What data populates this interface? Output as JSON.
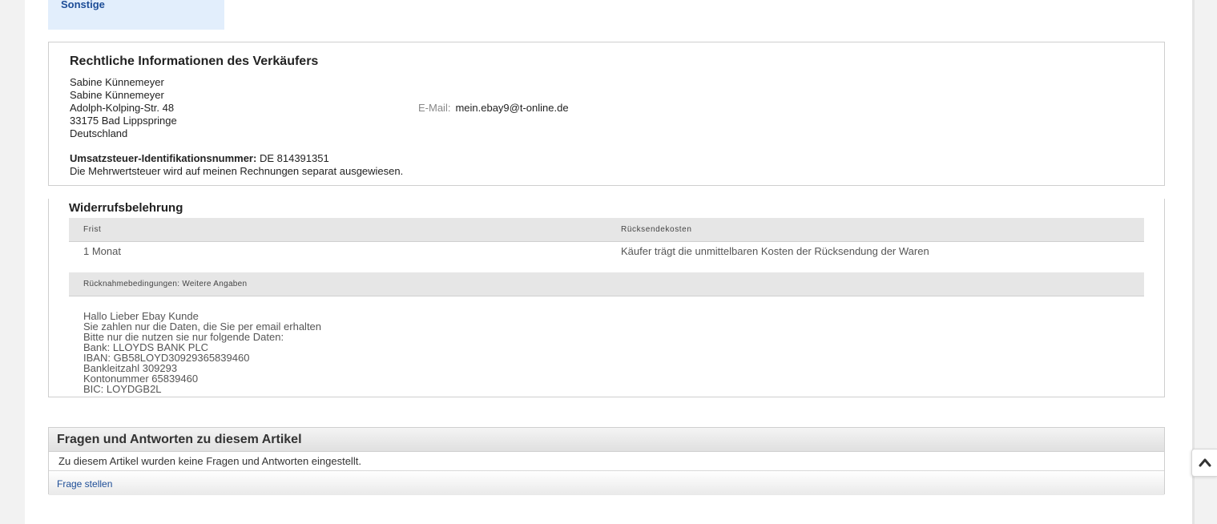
{
  "tabs": {
    "sonstige": "Sonstige"
  },
  "legal": {
    "title": "Rechtliche Informationen des Verkäufers",
    "address": [
      "Sabine Künnemeyer",
      "Sabine Künnemeyer",
      "Adolph-Kolping-Str. 48",
      "33175 Bad Lippspringe",
      "Deutschland"
    ],
    "email_label": "E-Mail:",
    "email_value": "mein.ebay9@t-online.de",
    "vat_label": "Umsatzsteuer-Identifikationsnummer:",
    "vat_value": "DE 814391351",
    "vat_note": "Die Mehrwertsteuer wird auf meinen Rechnungen separat ausgewiesen."
  },
  "widerruf": {
    "title": "Widerrufsbelehrung",
    "col_frist": "Frist",
    "col_kosten": "Rücksendekosten",
    "frist_value": "1 Monat",
    "kosten_value": "Käufer trägt die unmittelbaren Kosten der Rücksendung der Waren",
    "more_header": "Rücknahmebedingungen: Weitere Angaben",
    "more_lines": [
      "Hallo Lieber Ebay Kunde",
      "Sie zahlen nur die Daten, die Sie per email erhalten",
      "Bitte nur die nutzen sie nur folgende Daten:",
      "Bank: LLOYDS BANK PLC",
      "IBAN: GB58LOYD30929365839460",
      "Bankleitzahl 309293",
      "Kontonummer 65839460",
      "BIC: LOYDGB2L"
    ]
  },
  "qa": {
    "title": "Fragen und Antworten zu diesem Artikel",
    "empty_text": "Zu diesem Artikel wurden keine Fragen und Antworten eingestellt.",
    "ask_link": "Frage stellen"
  },
  "icons": {
    "scroll_top": "chevron-up-icon"
  },
  "colors": {
    "link": "#1d4d97",
    "tab_bg": "#e2eefc",
    "header_bg": "#e6e6e6"
  }
}
